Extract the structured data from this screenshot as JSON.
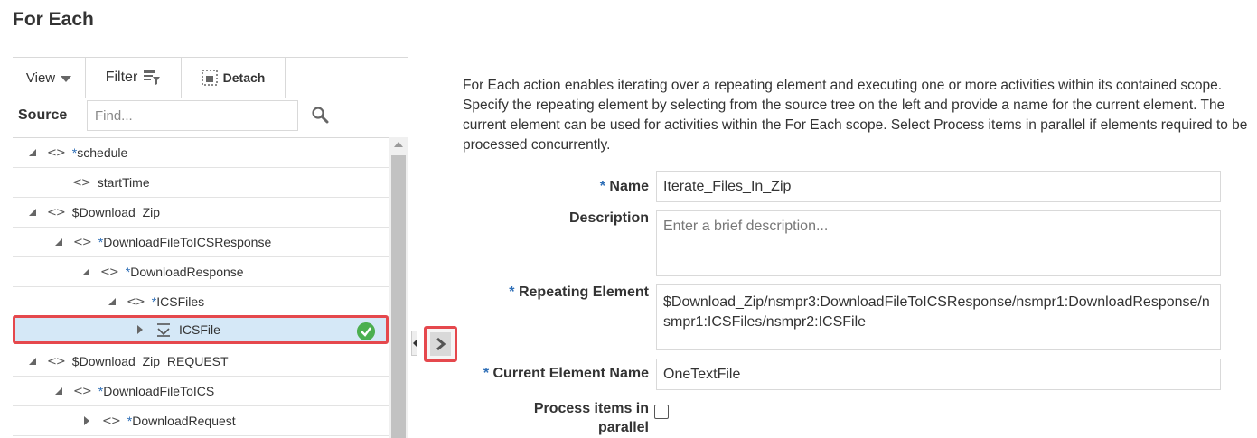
{
  "title": "For Each",
  "toolbar": {
    "view_label": "View",
    "filter_label": "Filter",
    "detach_label": "Detach"
  },
  "source": {
    "label": "Source",
    "placeholder": "Find..."
  },
  "tree": [
    {
      "label": "schedule",
      "star": true,
      "state": "open",
      "level": 0
    },
    {
      "label": "startTime",
      "star": false,
      "state": "none",
      "level": 1
    },
    {
      "label": "$Download_Zip",
      "star": false,
      "state": "open",
      "level": 0
    },
    {
      "label": "DownloadFileToICSResponse",
      "star": true,
      "state": "open",
      "level": 1
    },
    {
      "label": "DownloadResponse",
      "star": true,
      "state": "open",
      "level": 2
    },
    {
      "label": "ICSFiles",
      "star": true,
      "state": "open",
      "level": 3
    },
    {
      "label": "ICSFile",
      "star": false,
      "state": "closed",
      "level": 4,
      "selected": true,
      "repeating": true
    },
    {
      "label": "$Download_Zip_REQUEST",
      "star": false,
      "state": "open",
      "level": 0
    },
    {
      "label": "DownloadFileToICS",
      "star": true,
      "state": "open",
      "level": 1
    },
    {
      "label": "DownloadRequest",
      "star": true,
      "state": "closed",
      "level": 2
    }
  ],
  "description": "For Each action enables iterating over a repeating element and executing one or more activities within its contained scope. Specify the repeating element by selecting from the source tree on the left and provide a name for the current element. The current element can be used for activities within the For Each scope. Select Process items in parallel if elements required to be processed concurrently.",
  "form": {
    "name_label": "Name",
    "name_value": "Iterate_Files_In_Zip",
    "description_label": "Description",
    "description_placeholder": "Enter a brief description...",
    "repeating_label": "Repeating Element",
    "repeating_value": "$Download_Zip/nsmpr3:DownloadFileToICSResponse/nsmpr1:DownloadResponse/nsmpr1:ICSFiles/nsmpr2:ICSFile",
    "current_label": "Current Element Name",
    "current_value": "OneTextFile",
    "parallel_label_1": "Process items in",
    "parallel_label_2": "parallel",
    "required_mark": "*"
  },
  "colors": {
    "accent": "#2f6fb7",
    "selected_row": "#d5e8f7",
    "highlight": "#e5484d",
    "check": "#4caf50"
  },
  "icons": {
    "view_dropdown": "chevron-down-icon",
    "filter": "filter-icon",
    "detach": "detach-icon",
    "search": "search-icon",
    "element": "code-brackets-icon",
    "repeating": "repeating-element-icon",
    "valid": "check-circle-icon",
    "move": "chevron-right-icon"
  }
}
